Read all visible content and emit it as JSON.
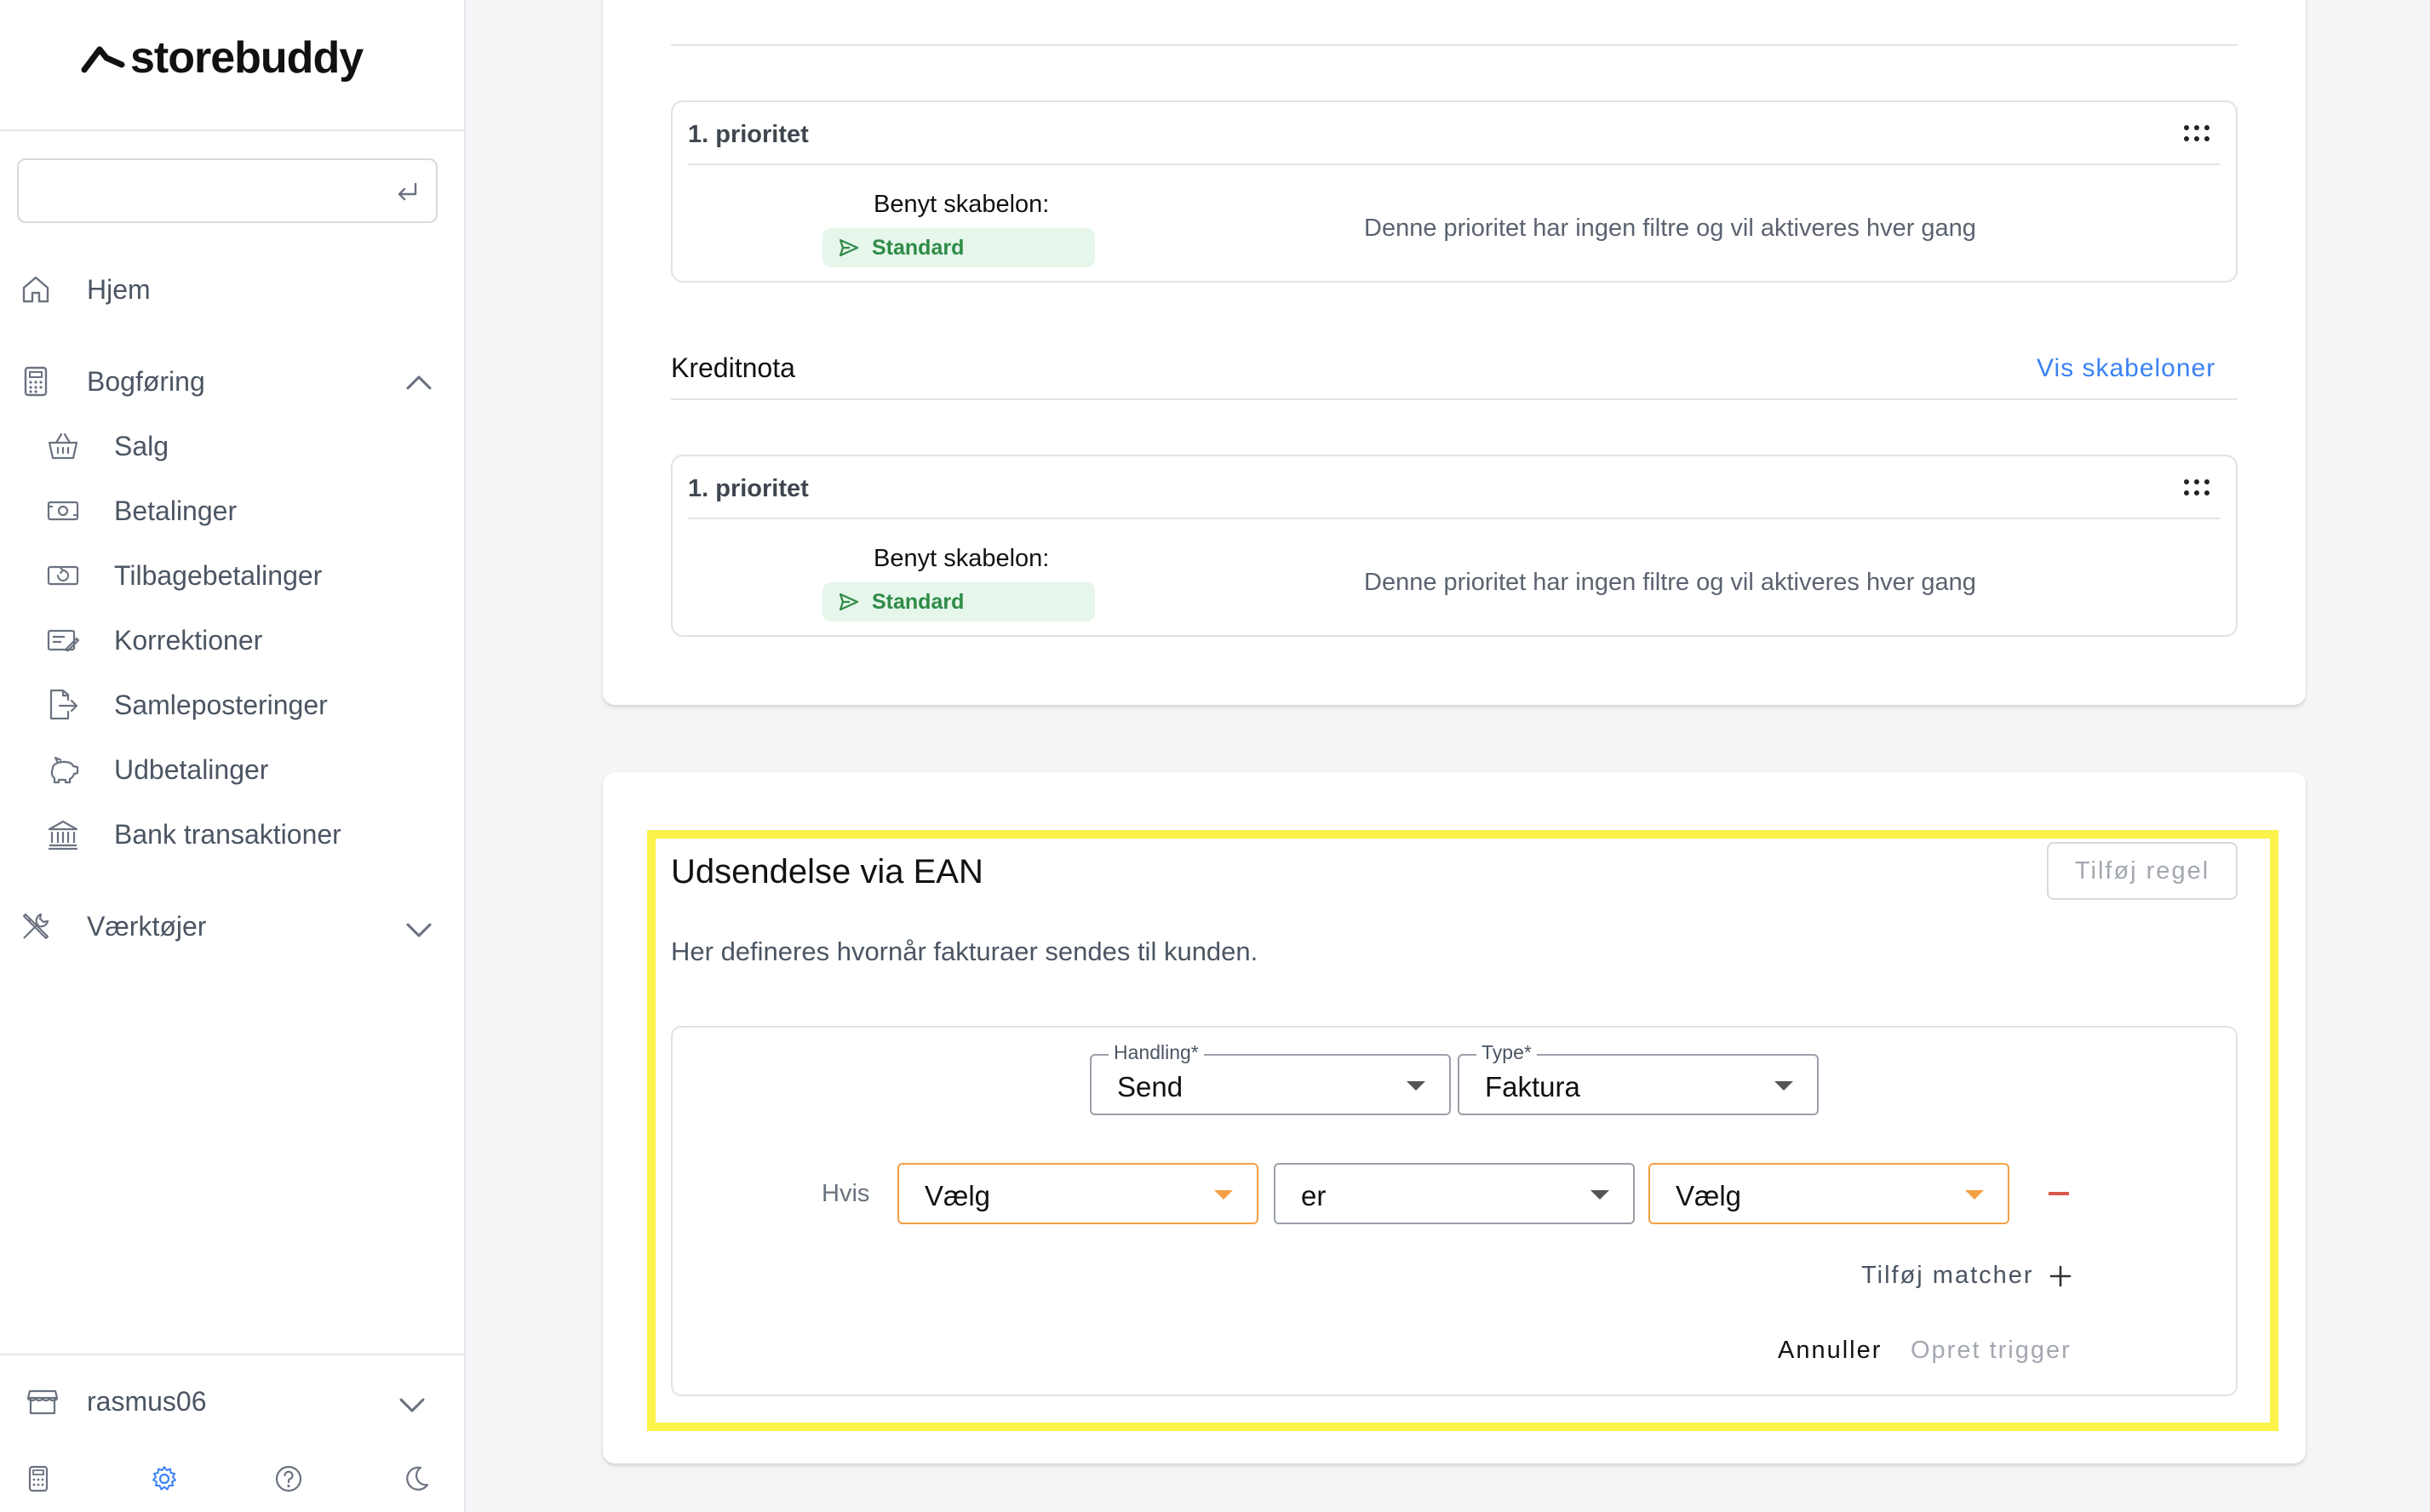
{
  "sidebar": {
    "logo_text": "storebuddy",
    "search": {
      "value": "",
      "placeholder": ""
    },
    "home_label": "Hjem",
    "bogforing": {
      "label": "Bogføring",
      "items": [
        {
          "label": "Salg",
          "icon": "basket-icon"
        },
        {
          "label": "Betalinger",
          "icon": "banknote-icon"
        },
        {
          "label": "Tilbagebetalinger",
          "icon": "refund-icon"
        },
        {
          "label": "Korrektioner",
          "icon": "correction-icon"
        },
        {
          "label": "Samleposteringer",
          "icon": "document-export-icon"
        },
        {
          "label": "Udbetalinger",
          "icon": "piggy-bank-icon"
        },
        {
          "label": "Bank transaktioner",
          "icon": "bank-icon"
        }
      ]
    },
    "tools_label": "Værktøjer",
    "account_label": "rasmus06"
  },
  "main": {
    "faktura_priority": {
      "title": "1. prioritet",
      "template_label": "Benyt skabelon:",
      "template_badge": "Standard",
      "note": "Denne prioritet har ingen filtre og vil aktiveres hver gang"
    },
    "kreditnota": {
      "title": "Kreditnota",
      "link": "Vis skabeloner",
      "priority": {
        "title": "1. prioritet",
        "template_label": "Benyt skabelon:",
        "template_badge": "Standard",
        "note": "Denne prioritet har ingen filtre og vil aktiveres hver gang"
      }
    },
    "ean": {
      "title": "Udsendelse via EAN",
      "add_rule": "Tilføj regel",
      "subtitle": "Her defineres hvornår fakturaer sendes til kunden.",
      "handling": {
        "label": "Handling*",
        "value": "Send"
      },
      "type": {
        "label": "Type*",
        "value": "Faktura"
      },
      "condition_label": "Hvis",
      "condition_field": "Vælg",
      "condition_operator": "er",
      "condition_value": "Vælg",
      "add_matcher": "Tilføj matcher",
      "cancel": "Annuller",
      "create": "Opret trigger"
    }
  },
  "colors": {
    "accent_blue": "#3b82f6",
    "badge_green": "#2e8b47",
    "badge_bg": "#e6f6ea",
    "highlight": "#fbf34a",
    "warning_orange": "#f5a045",
    "remove_red": "#d95848"
  }
}
